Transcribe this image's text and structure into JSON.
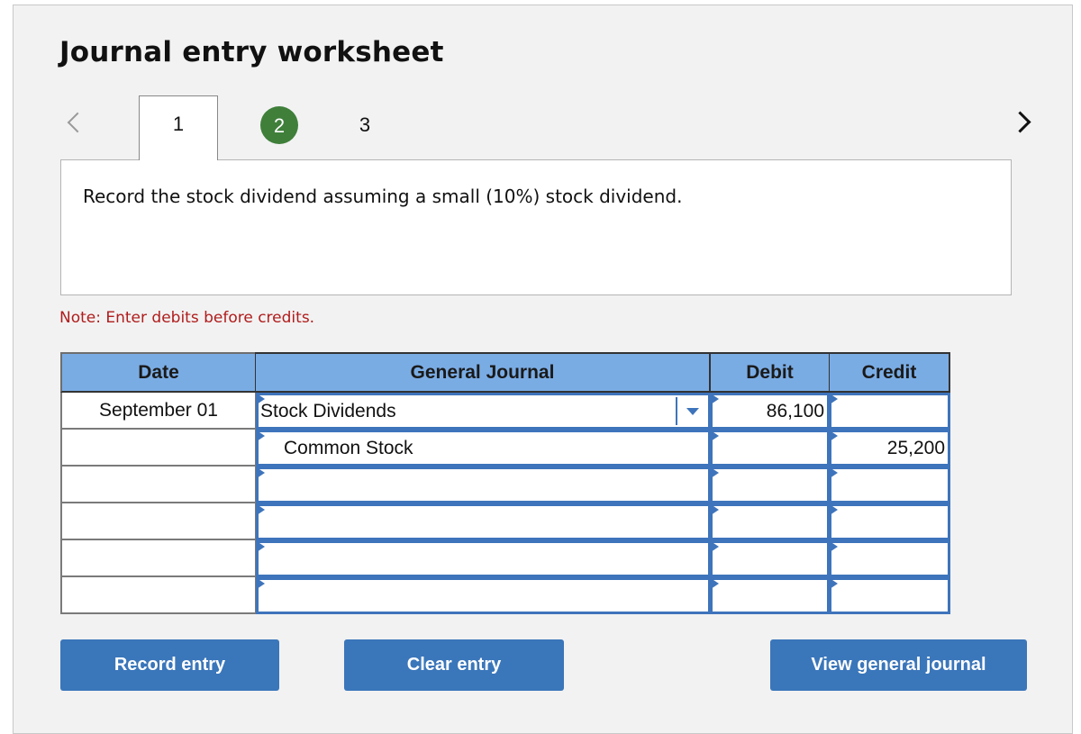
{
  "title": "Journal entry worksheet",
  "nav": {
    "prev_icon": "chevron-left-icon",
    "next_icon": "chevron-right-icon",
    "tabs": [
      {
        "label": "1",
        "state": "active"
      },
      {
        "label": "2",
        "state": "completed"
      },
      {
        "label": "3",
        "state": "default"
      }
    ],
    "completed_color": "#3f7f3a"
  },
  "question": "Record the stock dividend assuming a small (10%) stock dividend.",
  "note": "Note: Enter debits before credits.",
  "journal": {
    "headers": {
      "date": "Date",
      "general_journal": "General Journal",
      "debit": "Debit",
      "credit": "Credit"
    },
    "header_color": "#7aace4",
    "rows": [
      {
        "date": "September 01",
        "account": "Stock Dividends",
        "debit": "86,100",
        "credit": ""
      },
      {
        "date": "",
        "account": "Common Stock",
        "debit": "",
        "credit": "25,200"
      },
      {
        "date": "",
        "account": "",
        "debit": "",
        "credit": ""
      },
      {
        "date": "",
        "account": "",
        "debit": "",
        "credit": ""
      },
      {
        "date": "",
        "account": "",
        "debit": "",
        "credit": ""
      },
      {
        "date": "",
        "account": "",
        "debit": "",
        "credit": ""
      }
    ]
  },
  "buttons": {
    "record": "Record entry",
    "clear": "Clear entry",
    "view": "View general journal",
    "color": "#3a76ba"
  }
}
